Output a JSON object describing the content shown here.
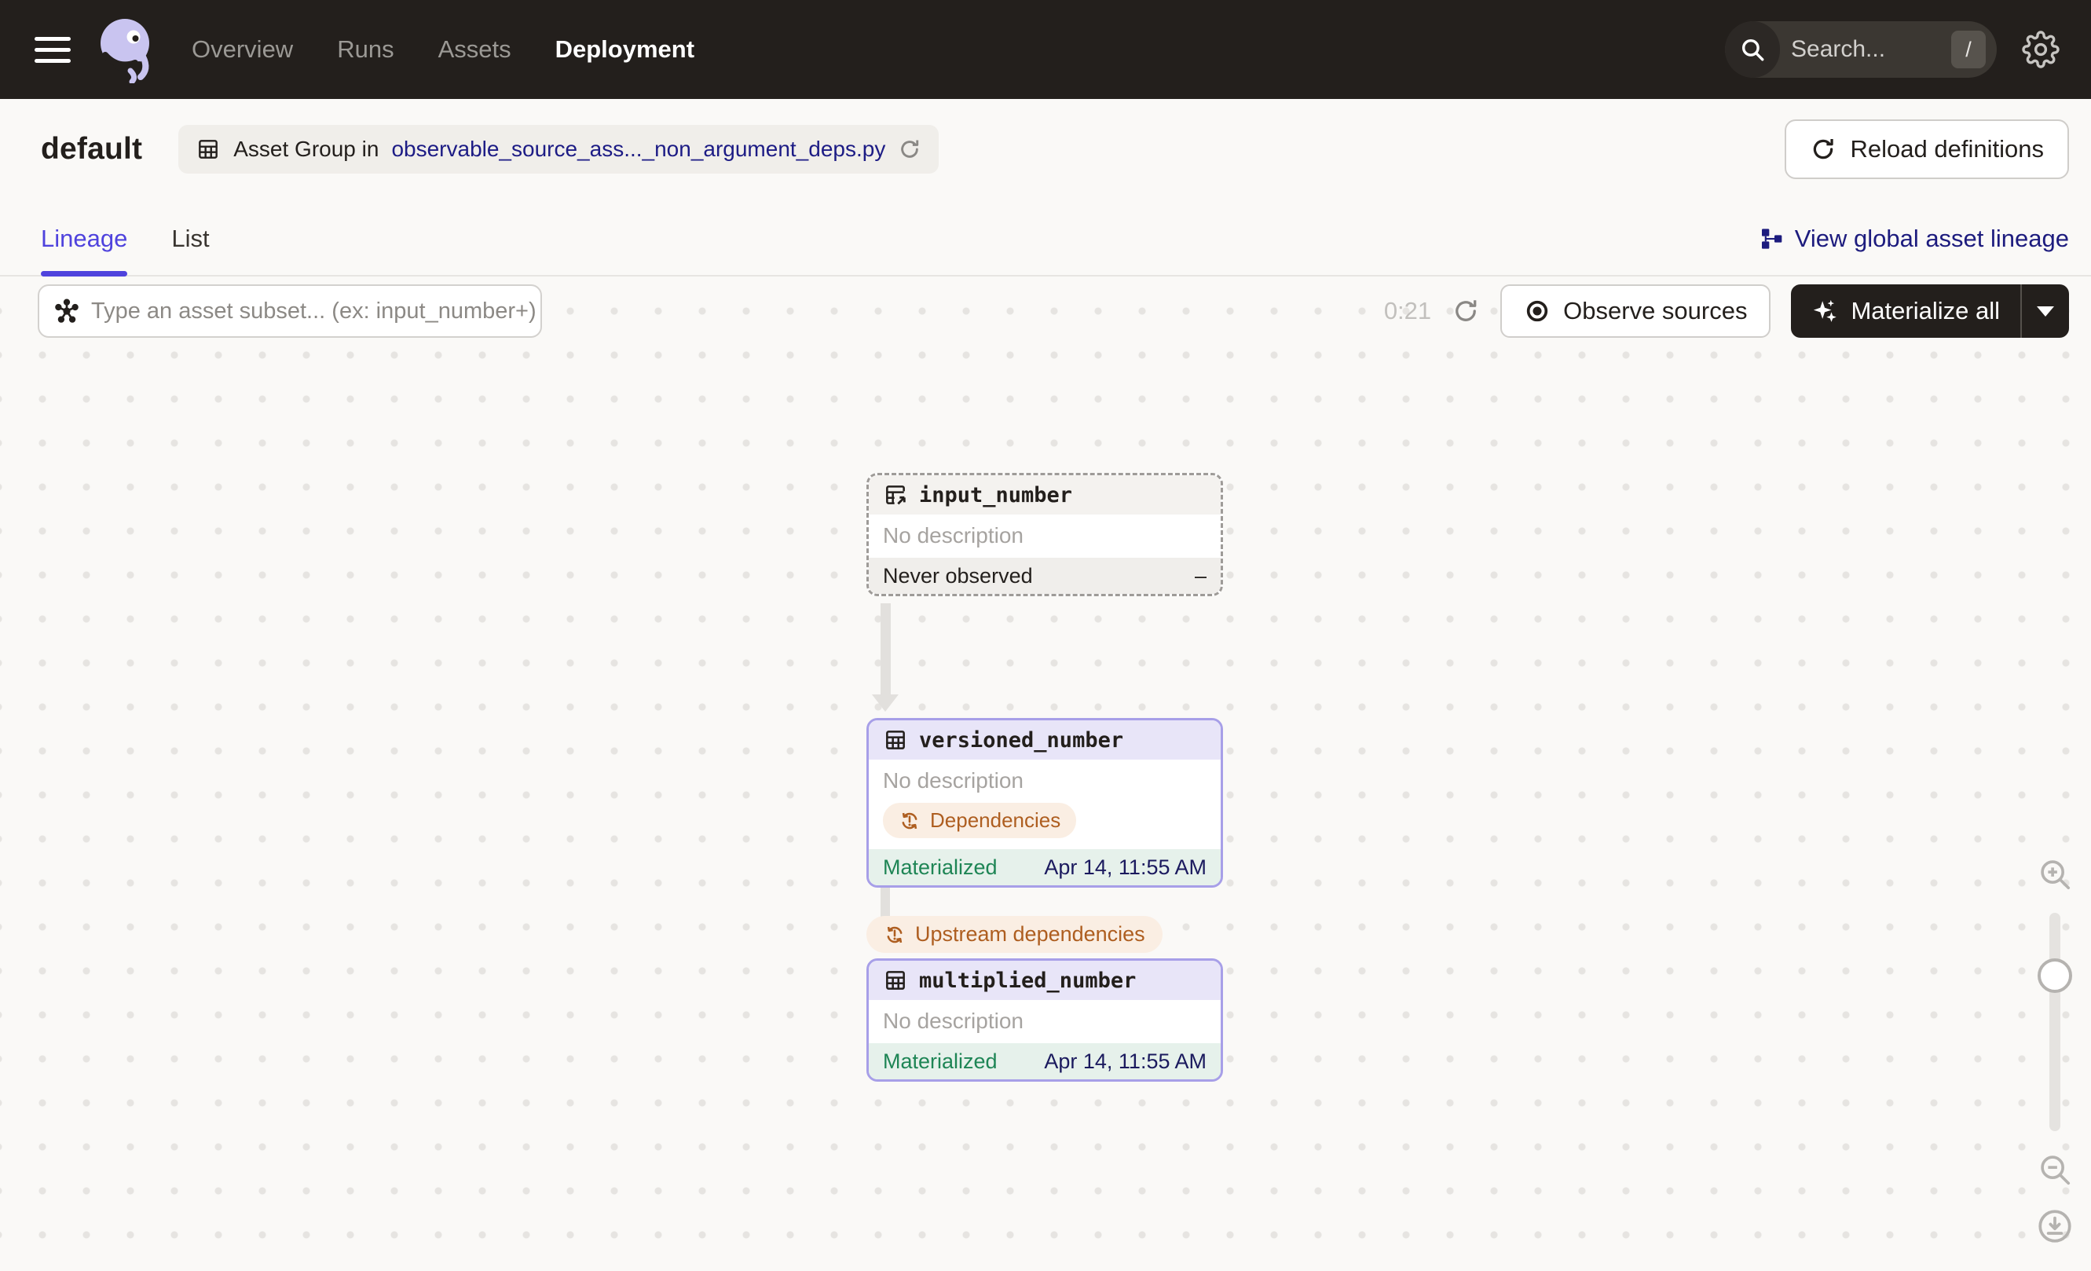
{
  "topbar": {
    "nav": [
      {
        "label": "Overview",
        "active": false
      },
      {
        "label": "Runs",
        "active": false
      },
      {
        "label": "Assets",
        "active": false
      },
      {
        "label": "Deployment",
        "active": true
      }
    ],
    "search_placeholder": "Search...",
    "search_shortcut": "/"
  },
  "header": {
    "title": "default",
    "asset_group_prefix": "Asset Group in",
    "asset_group_link": "observable_source_ass..._non_argument_deps.py",
    "reload_button": "Reload definitions"
  },
  "tabs": {
    "items": [
      {
        "label": "Lineage",
        "active": true
      },
      {
        "label": "List",
        "active": false
      }
    ],
    "global_lineage_link": "View global asset lineage"
  },
  "toolbar": {
    "filter_placeholder": "Type an asset subset... (ex: input_number+)",
    "timer": "0:21",
    "observe_button": "Observe sources",
    "materialize_button": "Materialize all"
  },
  "graph": {
    "nodes": [
      {
        "name": "input_number",
        "description": "No description",
        "status": "Never observed",
        "status_value": "–",
        "type": "observable-source-asset"
      },
      {
        "name": "versioned_number",
        "description": "No description",
        "badge": "Dependencies",
        "status": "Materialized",
        "status_value": "Apr 14, 11:55 AM",
        "type": "asset"
      },
      {
        "name": "multiplied_number",
        "description": "No description",
        "status": "Materialized",
        "status_value": "Apr 14, 11:55 AM",
        "type": "asset"
      }
    ],
    "edge_badge": "Upstream dependencies"
  },
  "colors": {
    "topbar_bg": "#231F1C",
    "canvas_bg": "#FAF9F7",
    "accent_blurple": "#4F43DD",
    "link_navy": "#1D1C85",
    "status_green": "#1E8555",
    "timestamp_navy": "#1B1A5E",
    "warning_orange": "#AE5E20",
    "warning_bg": "#FAEEE3",
    "asset_border_lavender": "#A79FE8",
    "asset_header_bg": "#E8E5F8",
    "materialized_footer_bg": "#E6F1EB"
  }
}
